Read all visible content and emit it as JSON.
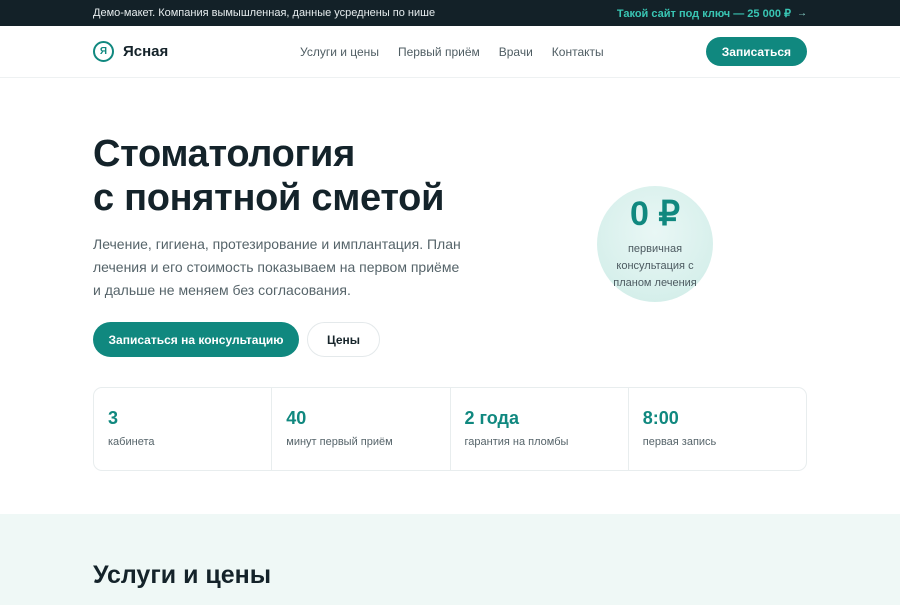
{
  "topbar": {
    "notice": "Демо-макет. Компания вымышленная, данные усреднены по нише",
    "promo": "Такой сайт под ключ — 25 000 ₽",
    "promo_arrow": "→"
  },
  "header": {
    "logo_mark": "Я",
    "logo_text": "Ясная",
    "nav": [
      "Услуги и цены",
      "Первый приём",
      "Врачи",
      "Контакты"
    ],
    "cta": "Записаться"
  },
  "hero": {
    "title_line1": "Стоматология",
    "title_line2": "с понятной сметой",
    "lead": "Лечение, гигиена, протезирование и имплантация. План лечения и его стоимость показываем на первом приёме и дальше не меняем без согласования.",
    "primary_button": "Записаться на консультацию",
    "secondary_button": "Цены",
    "badge_price": "0 ₽",
    "badge_caption": "первичная консультация с планом лечения"
  },
  "stats": [
    {
      "value": "3",
      "label": "кабинета"
    },
    {
      "value": "40",
      "label": "минут первый приём"
    },
    {
      "value": "2 года",
      "label": "гарантия на пломбы"
    },
    {
      "value": "8:00",
      "label": "первая запись"
    }
  ],
  "services": {
    "title": "Услуги и цены"
  },
  "colors": {
    "accent": "#10887f",
    "topbar_bg": "#132128",
    "promo": "#39c6b4",
    "section_bg": "#eff8f6"
  }
}
